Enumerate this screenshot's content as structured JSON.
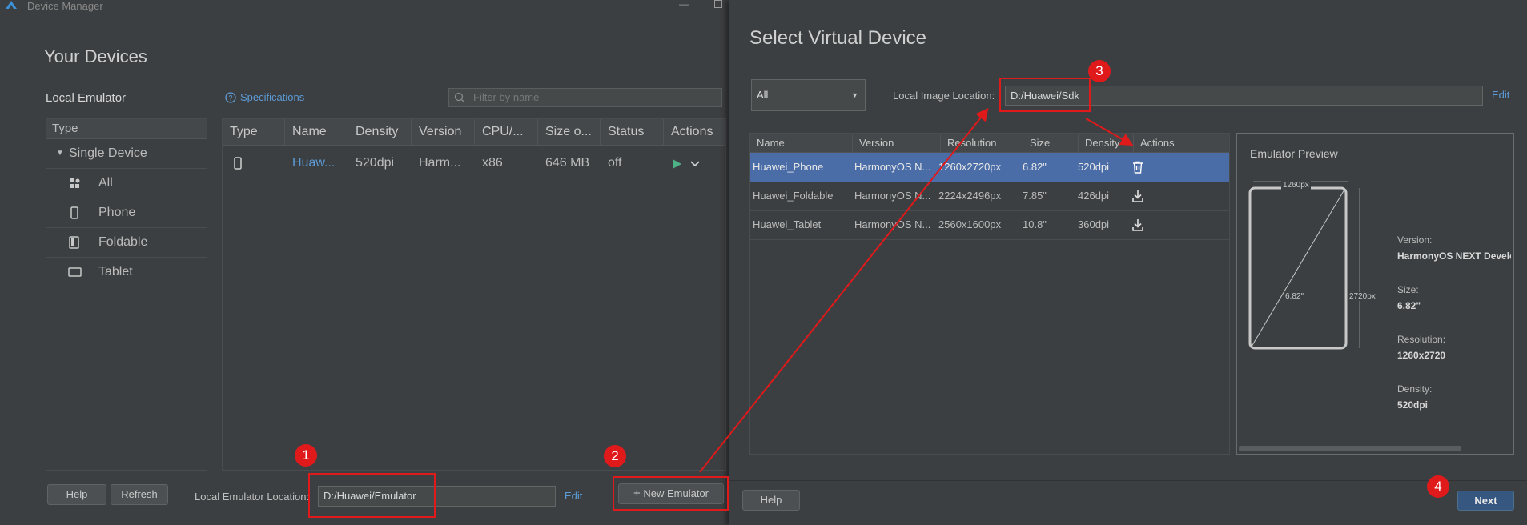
{
  "window": {
    "title": "Device Manager"
  },
  "left": {
    "heading": "Your Devices",
    "tab": "Local Emulator",
    "type_header": "Type",
    "single_device": "Single Device",
    "types": [
      {
        "label": "All"
      },
      {
        "label": "Phone"
      },
      {
        "label": "Foldable"
      },
      {
        "label": "Tablet"
      }
    ],
    "specifications_link": "Specifications",
    "filter_placeholder": "Filter by name",
    "columns": [
      "Type",
      "Name",
      "Density",
      "Version",
      "CPU/...",
      "Size o...",
      "Status",
      "Actions"
    ],
    "row": {
      "name": "Huaw...",
      "density": "520dpi",
      "version": "Harm...",
      "cpu": "x86",
      "size": "646 MB",
      "status": "off"
    },
    "help_button": "Help",
    "refresh_button": "Refresh",
    "location_label": "Local Emulator Location:",
    "location_value": "D:/Huawei/Emulator",
    "edit_link": "Edit",
    "new_emulator_button": "New Emulator"
  },
  "right": {
    "heading": "Select Virtual Device",
    "category_select": "All",
    "image_location_label": "Local Image Location:",
    "image_location_value": "D:/Huawei/Sdk",
    "edit_link": "Edit",
    "columns": [
      "Name",
      "Version",
      "Resolution",
      "Size",
      "Density",
      "Actions"
    ],
    "rows": [
      {
        "name": "Huawei_Phone",
        "version": "HarmonyOS N...",
        "resolution": "1260x2720px",
        "size": "6.82\"",
        "density": "520dpi",
        "action": "delete-icon"
      },
      {
        "name": "Huawei_Foldable",
        "version": "HarmonyOS N...",
        "resolution": "2224x2496px",
        "size": "7.85\"",
        "density": "426dpi",
        "action": "download-icon"
      },
      {
        "name": "Huawei_Tablet",
        "version": "HarmonyOS N...",
        "resolution": "2560x1600px",
        "size": "10.8\"",
        "density": "360dpi",
        "action": "download-icon"
      }
    ],
    "preview": {
      "title": "Emulator Preview",
      "width_label": "1260px",
      "height_label": "2720px",
      "diag_label": "6.82\"",
      "version_label": "Version:",
      "version_value": "HarmonyOS NEXT Develo",
      "size_label": "Size:",
      "size_value": "6.82\"",
      "resolution_label": "Resolution:",
      "resolution_value": "1260x2720",
      "density_label": "Density:",
      "density_value": "520dpi"
    },
    "help_button": "Help",
    "next_button": "Next"
  },
  "annotations": [
    "1",
    "2",
    "3",
    "4"
  ],
  "colors": {
    "accent": "#5c9bd6",
    "selected_row": "#4a6da7",
    "annotation_red": "#e0191b",
    "run_green": "#4fb286"
  }
}
